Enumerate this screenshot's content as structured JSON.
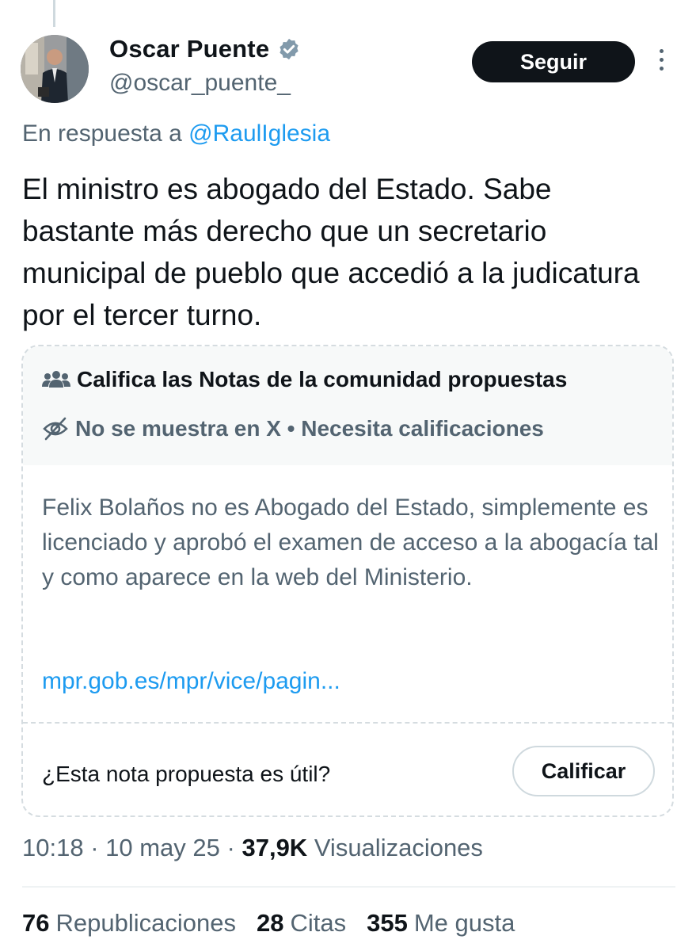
{
  "author": {
    "name": "Oscar Puente",
    "handle": "@oscar_puente_",
    "follow_label": "Seguir"
  },
  "reply": {
    "prefix": "En respuesta a ",
    "mention": "@RaulIglesia"
  },
  "tweet": {
    "text": "El ministro es abogado del Estado. Sabe bastante más derecho que un secretario municipal de pueblo que accedió a la judicatura por el tercer turno."
  },
  "community_note": {
    "header_title": "Califica las Notas de la comunidad propuestas",
    "status": "No se muestra en X • Necesita calificaciones",
    "body": "Felix Bolaños no es Abogado del Estado, simplemente es licenciado y aprobó el examen de acceso a la abogacía tal y como aparece en la web del Ministerio.",
    "link": "mpr.gob.es/mpr/vice/pagin...",
    "question": "¿Esta nota propuesta es útil?",
    "rate_label": "Calificar"
  },
  "meta": {
    "time": "10:18",
    "separator": " · ",
    "date": "10 may 25",
    "views_count": "37,9K",
    "views_label": " Visualizaciones"
  },
  "stats": [
    {
      "count": "76",
      "label": "Republicaciones"
    },
    {
      "count": "28",
      "label": "Citas"
    },
    {
      "count": "355",
      "label": "Me gusta"
    }
  ],
  "colors": {
    "accent": "#1d9bf0",
    "text": "#0f1419",
    "secondary": "#536471"
  }
}
